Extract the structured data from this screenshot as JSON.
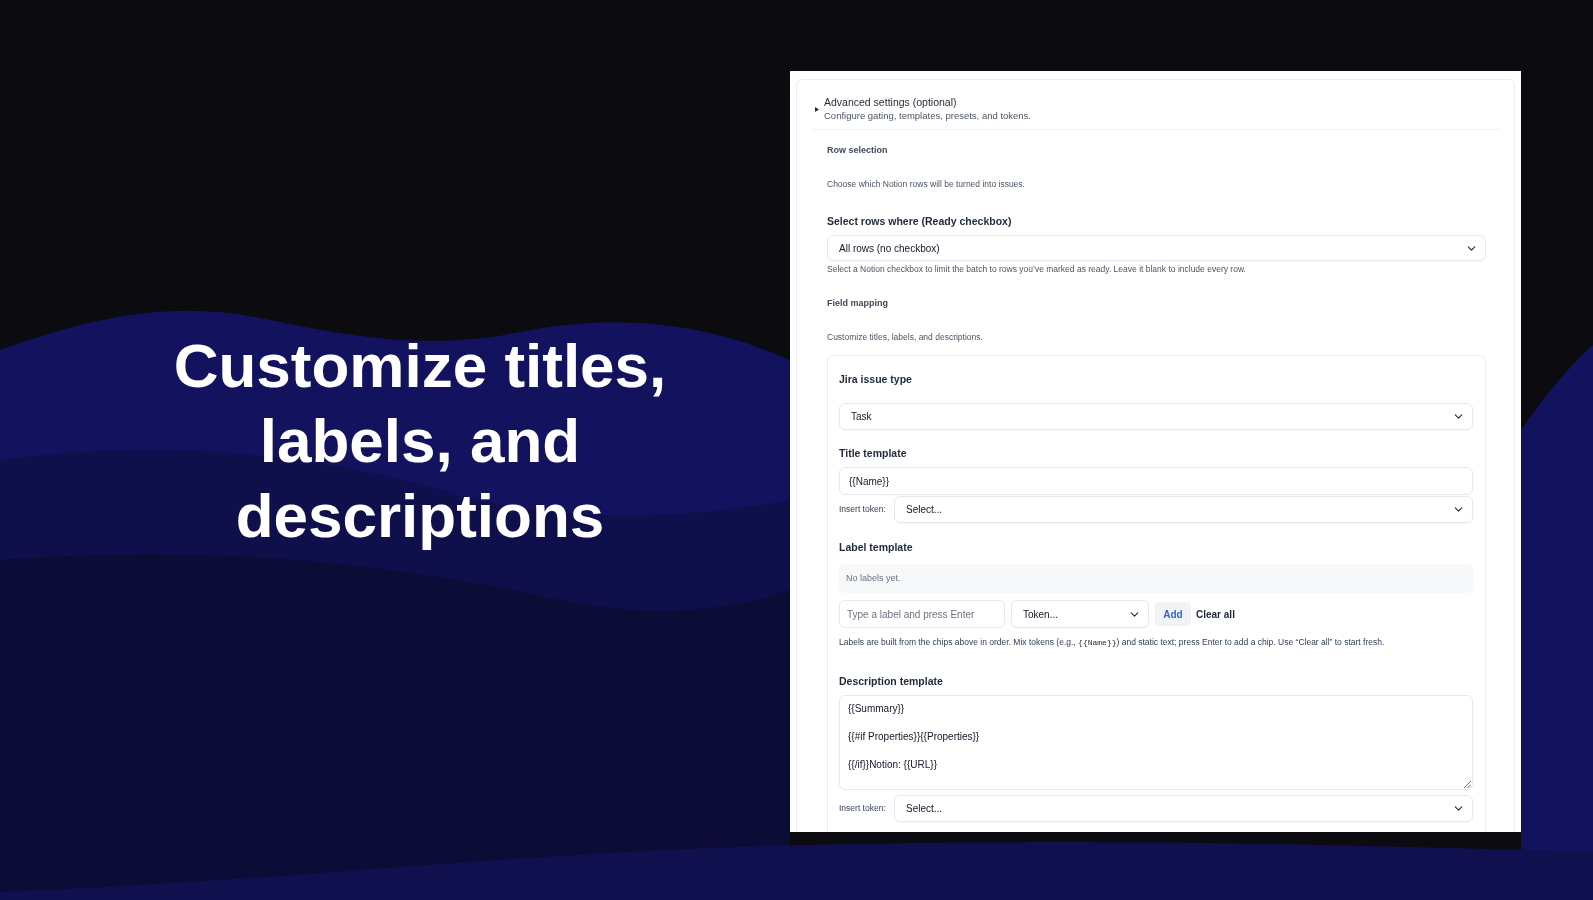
{
  "headline": "Customize titles, labels, and descriptions",
  "advanced_settings": {
    "title": "Advanced settings (optional)",
    "subtitle": "Configure gating, templates, presets, and tokens."
  },
  "row_selection": {
    "heading": "Row selection",
    "description": "Choose which Notion rows will be turned into issues.",
    "ready_field": {
      "label": "Select rows where (Ready checkbox)",
      "value": "All rows (no checkbox)",
      "help": "Select a Notion checkbox to limit the batch to rows you’ve marked as ready. Leave it blank to include every row."
    }
  },
  "field_mapping": {
    "heading": "Field mapping",
    "description": "Customize titles, labels, and descriptions.",
    "issue_type": {
      "label": "Jira issue type",
      "value": "Task"
    },
    "title_template": {
      "label": "Title template",
      "value": "{{Name}}",
      "insert_token": {
        "label": "Insert token:",
        "value": "Select..."
      }
    },
    "label_template": {
      "label": "Label template",
      "empty_text": "No labels yet.",
      "label_input": {
        "placeholder": "Type a label and press Enter"
      },
      "token_select": "Token...",
      "add_button": "Add",
      "clear_button": "Clear all",
      "help": [
        {
          "kind": "text",
          "text": "Labels are built from the chips above in order. Mix tokens (e.g., "
        },
        {
          "kind": "code",
          "text": "{{Name}}"
        },
        {
          "kind": "text",
          "text": ") and static text; press Enter to add a chip. Use “Clear all” to start fresh."
        }
      ]
    },
    "description_template": {
      "label": "Description template",
      "value": "{{Summary}}\n\n{{#if Properties}}{{Properties}}\n\n{{/if}}Notion: {{URL}}",
      "insert_token": {
        "label": "Insert token:",
        "value": "Select..."
      }
    }
  }
}
